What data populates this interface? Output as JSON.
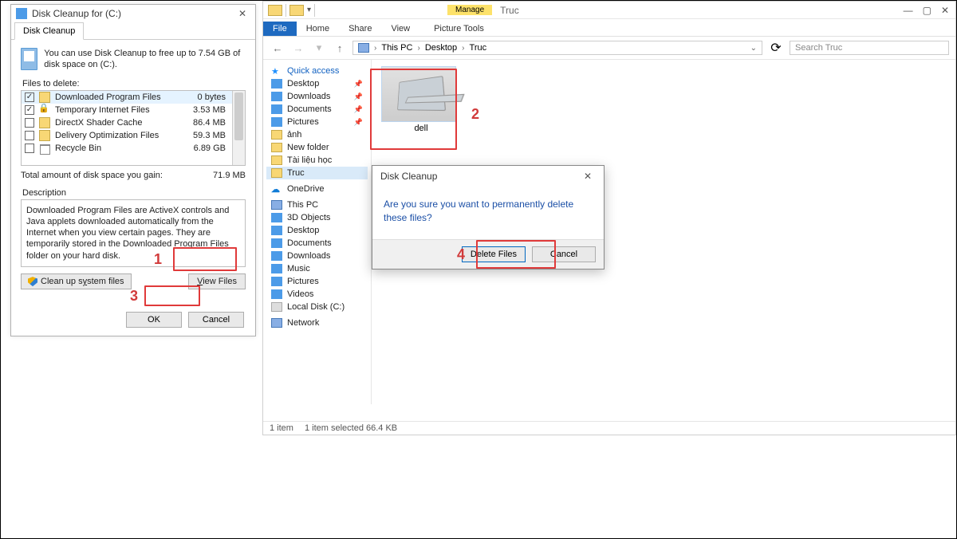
{
  "disk_cleanup": {
    "title": "Disk Cleanup for  (C:)",
    "tab": "Disk Cleanup",
    "intro": "You can use Disk Cleanup to free up to 7.54 GB of disk space on  (C:).",
    "files_label": "Files to delete:",
    "files": [
      {
        "name": "Downloaded Program Files",
        "size": "0 bytes",
        "checked": true,
        "icon": "folder",
        "sel": true
      },
      {
        "name": "Temporary Internet Files",
        "size": "3.53 MB",
        "checked": true,
        "icon": "lock"
      },
      {
        "name": "DirectX Shader Cache",
        "size": "86.4 MB",
        "checked": false,
        "icon": "folder"
      },
      {
        "name": "Delivery Optimization Files",
        "size": "59.3 MB",
        "checked": false,
        "icon": "folder"
      },
      {
        "name": "Recycle Bin",
        "size": "6.89 GB",
        "checked": false,
        "icon": "trash"
      }
    ],
    "total_label": "Total amount of disk space you gain:",
    "total_value": "71.9 MB",
    "desc_label": "Description",
    "description": "Downloaded Program Files are ActiveX controls and Java applets downloaded automatically from the Internet when you view certain pages. They are temporarily stored in the Downloaded Program Files folder on your hard disk.",
    "cleanup_btn": "Clean up system files",
    "view_files_btn": "View Files",
    "ok_btn": "OK",
    "cancel_btn": "Cancel"
  },
  "explorer": {
    "window_name": "Truc",
    "context_head": "Manage",
    "tabs": {
      "file": "File",
      "home": "Home",
      "share": "Share",
      "view": "View",
      "picture": "Picture Tools"
    },
    "crumbs": [
      "This PC",
      "Desktop",
      "Truc"
    ],
    "search_placeholder": "Search Truc",
    "nav": {
      "quick": "Quick access",
      "desktop": "Desktop",
      "downloads": "Downloads",
      "documents": "Documents",
      "pictures": "Pictures",
      "anh": "ảnh",
      "newfolder": "New folder",
      "tailieu": "Tài liệu học",
      "truc": "Truc",
      "onedrive": "OneDrive",
      "thispc": "This PC",
      "threeD": "3D Objects",
      "desktop2": "Desktop",
      "documents2": "Documents",
      "downloads2": "Downloads",
      "music": "Music",
      "pictures2": "Pictures",
      "videos": "Videos",
      "localdisk": "Local Disk (C:)",
      "network": "Network"
    },
    "item_label": "dell",
    "status_items": "1 item",
    "status_sel": "1 item selected  66.4 KB"
  },
  "confirm": {
    "title": "Disk Cleanup",
    "message": "Are you sure you want to permanently delete these files?",
    "delete_btn": "Delete Files",
    "cancel_btn": "Cancel"
  },
  "callouts": {
    "n1": "1",
    "n2": "2",
    "n3": "3",
    "n4": "4"
  }
}
